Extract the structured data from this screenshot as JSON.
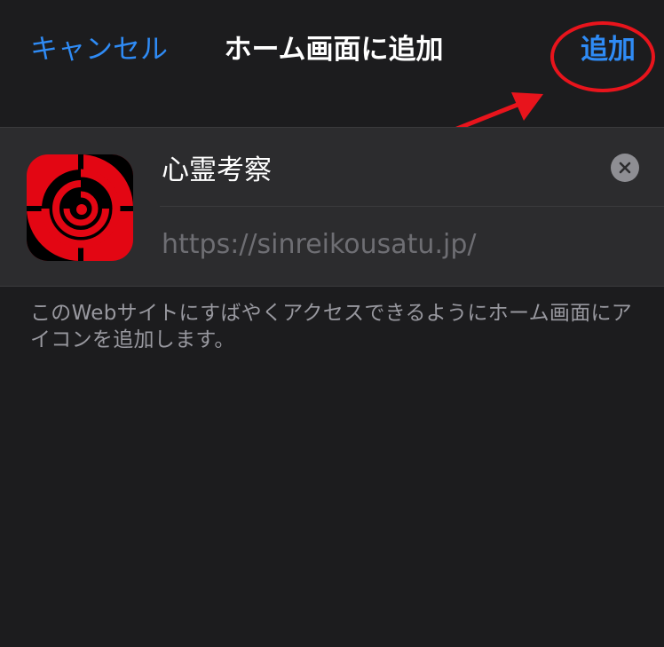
{
  "navbar": {
    "cancel_label": "キャンセル",
    "title": "ホーム画面に追加",
    "add_label": "追加"
  },
  "bookmark": {
    "name": "心霊考察",
    "url": "https://sinreikousatu.jp/"
  },
  "description": "このWebサイトにすばやくアクセスできるようにホーム画面にアイコンを追加します。",
  "colors": {
    "background": "#1c1c1e",
    "card": "#2c2c2e",
    "accent": "#2f8bf5",
    "annotation": "#e8141c"
  },
  "icons": [
    "close-icon",
    "app-icon"
  ]
}
